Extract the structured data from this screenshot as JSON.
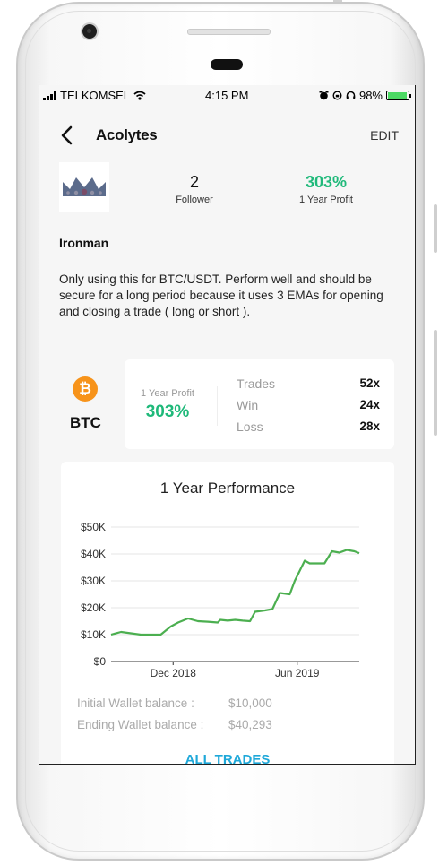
{
  "status_bar": {
    "carrier": "TELKOMSEL",
    "time": "4:15 PM",
    "battery": "98%",
    "icons": [
      "signal-icon",
      "wifi-icon",
      "alarm-icon",
      "rotation-lock-icon",
      "headphones-icon",
      "battery-icon"
    ]
  },
  "nav": {
    "title": "Acolytes",
    "edit_label": "EDIT",
    "back_icon": "chevron-left-icon"
  },
  "profile": {
    "avatar_icon": "crown-icon",
    "followers_count": "2",
    "followers_label": "Follower",
    "profit_value": "303%",
    "profit_label": "1 Year Profit",
    "strategy_name": "Ironman",
    "description": "Only using this for BTC/USDT. Perform well and should be secure for a long period because it uses  3 EMAs for opening and closing a trade ( long or short )."
  },
  "coin": {
    "symbol": "BTC",
    "icon": "bitcoin-icon",
    "color": "#f7931a"
  },
  "stats_card": {
    "profit_label": "1 Year Profit",
    "profit_value": "303%",
    "rows": [
      {
        "label": "Trades",
        "value": "52x"
      },
      {
        "label": "Win",
        "value": "24x"
      },
      {
        "label": "Loss",
        "value": "28x"
      }
    ]
  },
  "performance": {
    "title": "1 Year Performance",
    "initial_label": "Initial Wallet balance :",
    "initial_value": "$10,000",
    "ending_label": "Ending Wallet balance :",
    "ending_value": "$40,293",
    "all_trades_label": "ALL TRADES"
  },
  "chart_data": {
    "type": "line",
    "title": "",
    "xlabel": "",
    "ylabel": "",
    "y_ticks": [
      "$0",
      "$10K",
      "$20K",
      "$30K",
      "$40K",
      "$50K"
    ],
    "x_ticks": [
      {
        "label": "Dec 2018",
        "x": 0.25
      },
      {
        "label": "Jun 2019",
        "x": 0.75
      }
    ],
    "ylim": [
      0,
      50000
    ],
    "xlim": [
      0,
      1
    ],
    "grid": true,
    "color": "#4caf50",
    "series": [
      {
        "x": [
          0,
          0.04,
          0.08,
          0.12,
          0.16,
          0.2,
          0.24,
          0.27,
          0.31,
          0.35,
          0.39,
          0.43,
          0.44,
          0.47,
          0.5,
          0.53,
          0.56,
          0.58,
          0.62,
          0.65,
          0.68,
          0.72,
          0.74,
          0.78,
          0.8,
          0.83,
          0.86,
          0.89,
          0.92,
          0.95,
          0.98,
          1.0
        ],
        "y": [
          10000,
          11000,
          10500,
          10000,
          10000,
          10000,
          13000,
          14500,
          16000,
          15000,
          14800,
          14500,
          15500,
          15200,
          15500,
          15200,
          15000,
          18500,
          19000,
          19500,
          25500,
          25000,
          30000,
          37500,
          36500,
          36500,
          36500,
          41000,
          40500,
          41500,
          41000,
          40300
        ]
      }
    ]
  }
}
